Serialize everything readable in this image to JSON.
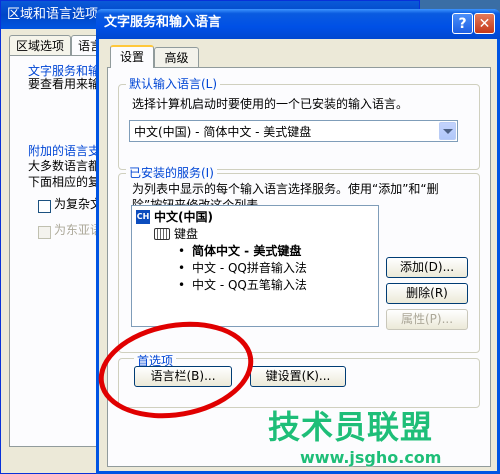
{
  "background_window": {
    "title": "区域和语言选项",
    "tabs": [
      "区域选项",
      "语言"
    ],
    "group1_label": "文字服务和输",
    "group1_text": "要查看用来输",
    "group2_label": "附加的语言支",
    "group2_lines": [
      "大多数语言都",
      "下面相应的复"
    ],
    "check1": "为复杂文",
    "check2": "为东亚语"
  },
  "dialog": {
    "title": "文字服务和输入语言",
    "help_button": "?",
    "close_button": "✕",
    "tabs": {
      "settings": "设置",
      "advanced": "高级"
    },
    "default_language": {
      "label": "默认输入语言(L)",
      "description": "选择计算机启动时要使用的一个已安装的输入语言。",
      "selected": "中文(中国) - 简体中文 - 美式键盘"
    },
    "installed_services": {
      "label": "已安装的服务(I)",
      "description_lines": [
        "为列表中显示的每个输入语言选择服务。使用“添加”和“删",
        "除”按钮来修改这个列表。"
      ],
      "lang_badge": "CH",
      "language": "中文(中国)",
      "category": "键盘",
      "items": [
        "简体中文 - 美式键盘",
        "中文 - QQ拼音输入法",
        "中文 - QQ五笔输入法"
      ],
      "add_button": "添加(D)...",
      "remove_button": "删除(R)",
      "properties_button": "属性(P)..."
    },
    "preferences": {
      "label": "首选项",
      "language_bar_button": "语言栏(B)...",
      "key_settings_button": "键设置(K)..."
    }
  },
  "watermark": {
    "title": "技术员联盟",
    "url": "www.jsgho.com"
  },
  "colors": {
    "title_bar": "#0050e6",
    "group_label": "#0046d5",
    "annotation": "#e00000",
    "watermark": "#1ebe78"
  }
}
